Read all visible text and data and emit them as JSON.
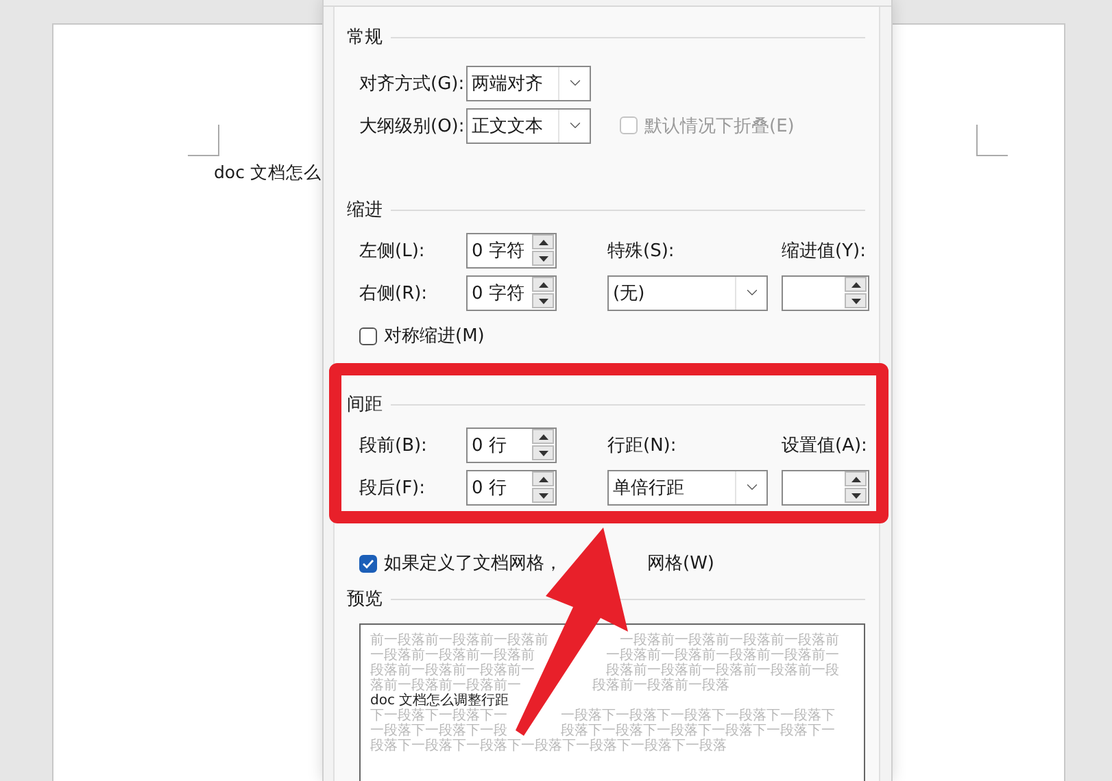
{
  "document": {
    "text": "doc 文档怎么"
  },
  "dialog": {
    "general": {
      "title": "常规",
      "fields": [
        {
          "label": "对齐方式(G):",
          "value": "两端对齐"
        },
        {
          "label": "大纲级别(O):",
          "value": "正文文本"
        }
      ],
      "collapse": {
        "label": "默认情况下折叠(E)",
        "checked": false,
        "disabled": true
      }
    },
    "indent": {
      "title": "缩进",
      "left": {
        "label": "左侧(L):",
        "value": "0 字符"
      },
      "right": {
        "label": "右侧(R):",
        "value": "0 字符"
      },
      "special": {
        "label": "特殊(S):",
        "value": "(无)"
      },
      "by": {
        "label": "缩进值(Y):"
      },
      "checkboxes": [
        {
          "label_parts": [
            "对称缩进(M)"
          ],
          "checked": false
        }
      ]
    },
    "spacing": {
      "title": "间距",
      "before": {
        "label": "段前(B):",
        "value": "0 行"
      },
      "after": {
        "label": "段后(F):",
        "value": "0 行"
      },
      "line": {
        "label": "行距(N):",
        "value": "单倍行距"
      },
      "at": {
        "label": "设置值(A):"
      },
      "checkboxes": [
        {
          "label_parts": [
            "如果定义了文档网格，",
            "网格(W)"
          ],
          "checked": true
        }
      ]
    },
    "preview": {
      "title": "预览",
      "lines": [
        {
          "kind": "context",
          "segments": [
            "前一段落前一段落前一段落前",
            "一段落前一段落前一段落前一段落前"
          ]
        },
        {
          "kind": "context",
          "segments": [
            "一段落前一段落前一段落前",
            "一段落前一段落前一段落前一段落前一"
          ]
        },
        {
          "kind": "context",
          "segments": [
            "段落前一段落前一段落前一",
            "段落前一段落前一段落前一段落前一段"
          ]
        },
        {
          "kind": "context",
          "segments": [
            "落前一段落前一段落前一",
            "段落前一段落前一段落"
          ]
        },
        {
          "kind": "sample",
          "segments": [
            "doc 文档怎么调整行距"
          ]
        },
        {
          "kind": "context",
          "segments": [
            "下一段落下一段落下一",
            "一段落下一段落下一段落下一段落下一段落下"
          ]
        },
        {
          "kind": "context",
          "segments": [
            "一段落下一段落下一段",
            "段落下一段落下一段落下一段落下一段落下一"
          ]
        },
        {
          "kind": "context",
          "segments": [
            "段落下一段落下一段落下一段落下一段落下一段落下一段落"
          ]
        }
      ]
    }
  }
}
